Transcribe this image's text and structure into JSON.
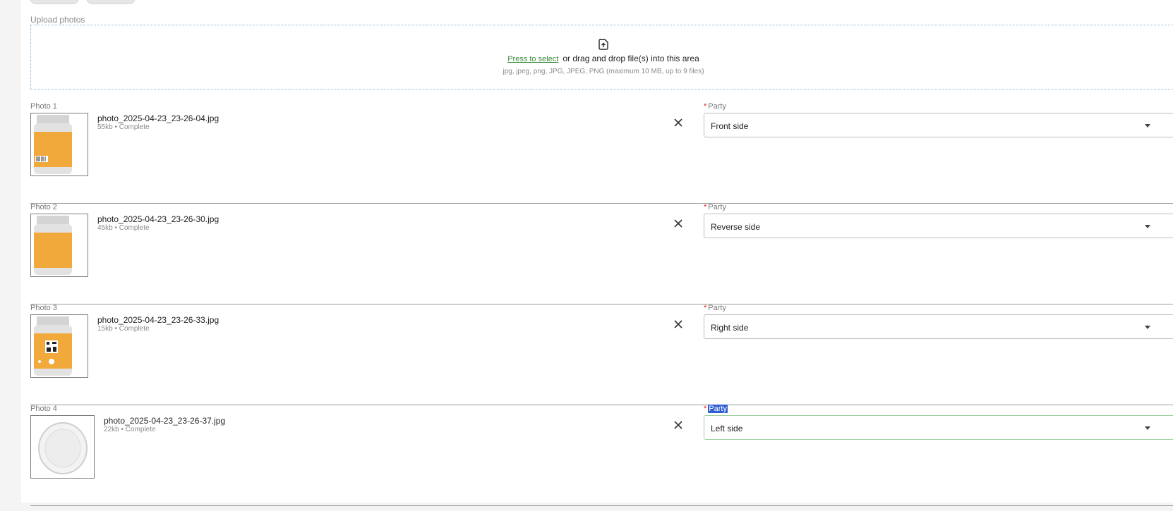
{
  "upload": {
    "label": "Upload photos",
    "link": "Press to select",
    "text": "or drag and drop file(s) into this area",
    "hint": "jpg, jpeg, png, JPG, JPEG, PNG (maximum 10 MB, up to 9 files)",
    "icon": "file-upload-icon"
  },
  "photos": [
    {
      "label": "Photo 1",
      "name": "photo_2025-04-23_23-26-04.jpg",
      "size": "55kb",
      "status": "Complete",
      "party_label": "Party",
      "party_value": "Front side"
    },
    {
      "label": "Photo 2",
      "name": "photo_2025-04-23_23-26-30.jpg",
      "size": "45kb",
      "status": "Complete",
      "party_label": "Party",
      "party_value": "Reverse side"
    },
    {
      "label": "Photo 3",
      "name": "photo_2025-04-23_23-26-33.jpg",
      "size": "15kb",
      "status": "Complete",
      "party_label": "Party",
      "party_value": "Right side"
    },
    {
      "label": "Photo 4",
      "name": "photo_2025-04-23_23-26-37.jpg",
      "size": "22kb",
      "status": "Complete",
      "party_label": "Party",
      "party_value": "Left side"
    }
  ],
  "required_mark": "*",
  "separator": "•",
  "colors": {
    "link": "#3d8a3d",
    "dropzone_border": "#9fc3dc",
    "required": "#d22222",
    "selection": "#2f5fd0",
    "active_border": "#9fd19f",
    "bottle_label": "#f2a93b"
  }
}
